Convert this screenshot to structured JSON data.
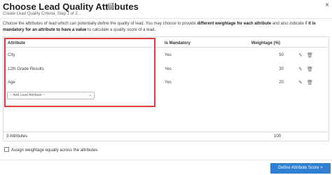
{
  "dialog": {
    "title": "Choose Lead Quality Attributes",
    "subtitle": "Create Lead Quality Criteria, Step 1 of 2...",
    "close_label": "×",
    "help_label": "?"
  },
  "description": {
    "part1": "Choose the attributes of lead which can potentially define the quality of lead. You may choose to provide ",
    "bold1": "different weightage for each attribute",
    "part2": " and also indicate if ",
    "bold2": "it is mandatory for an attribute to have a value",
    "part3": " to calculate a quality score of a lead."
  },
  "table": {
    "columns": {
      "attribute": "Attribute",
      "mandatory": "Is Mandatory",
      "weightage": "Weightage (%)"
    },
    "rows": [
      {
        "attribute": "City",
        "mandatory": "Yes",
        "weightage": "50"
      },
      {
        "attribute": "12th Grade Results",
        "mandatory": "Yes",
        "weightage": "30"
      },
      {
        "attribute": "Age",
        "mandatory": "Yes",
        "weightage": "20"
      }
    ],
    "add_select_placeholder": "-- Add Lead Attribute --",
    "footer": {
      "count": "3 Attributes",
      "total": "100"
    }
  },
  "options": {
    "assign_equally_label": "Assign weightage equally across the attributes",
    "assign_equally_checked": false
  },
  "actions": {
    "primary_label": "Define Attribute Score >"
  },
  "colors": {
    "primary": "#2f80d1",
    "highlight_frame": "#e03a3a"
  },
  "icons": {
    "edit": "pencil-icon",
    "delete": "trash-icon",
    "help": "help-circle-icon",
    "close": "close-icon",
    "dropdown": "chevron-down-icon"
  }
}
